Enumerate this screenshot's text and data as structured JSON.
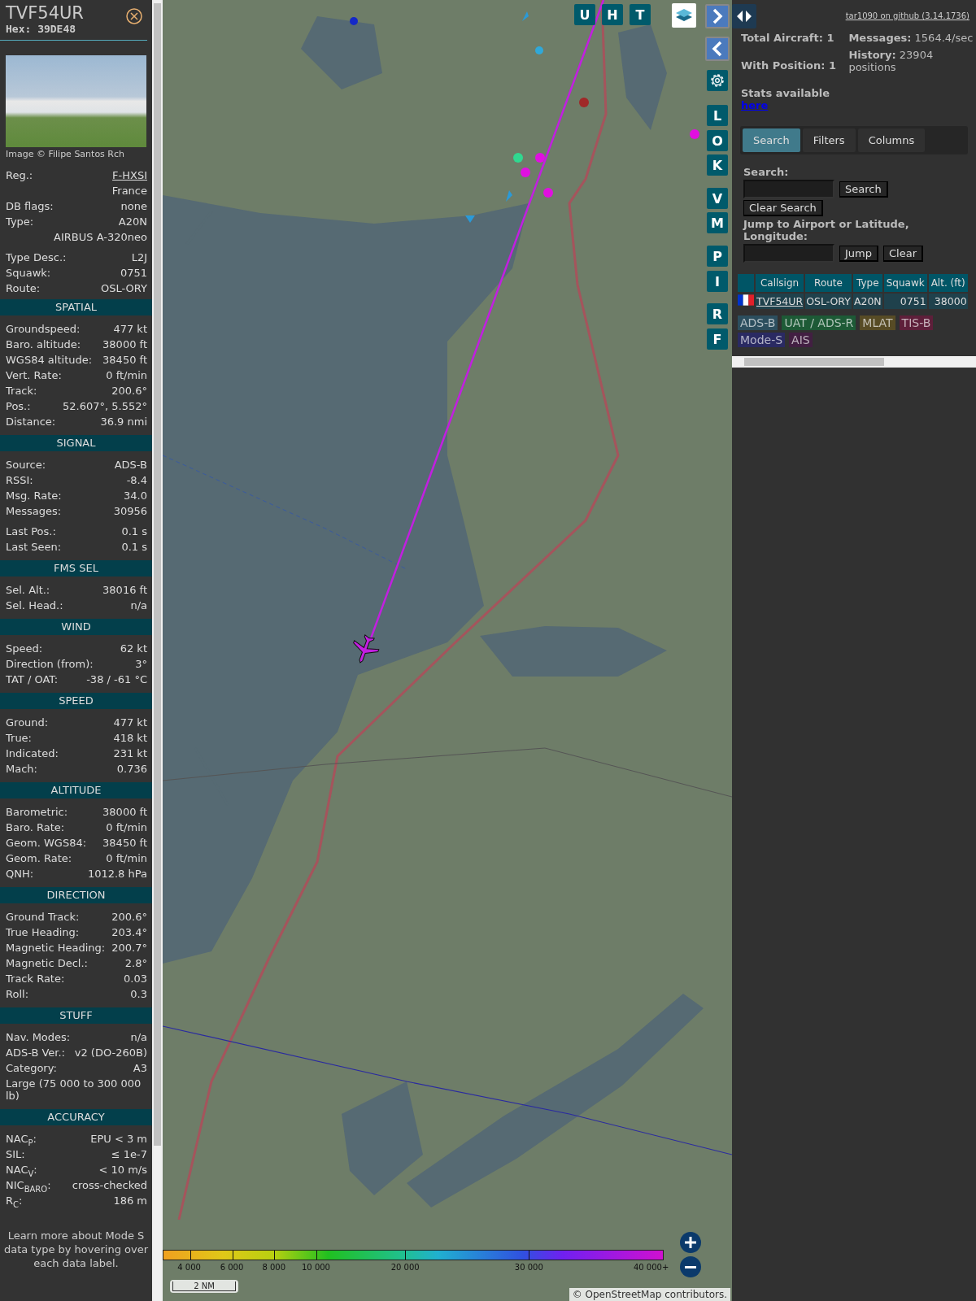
{
  "detail": {
    "callsign": "TVF54UR",
    "hex": "Hex: 39DE48",
    "photo_credit": "Image © Filipe Santos Rch",
    "info_groups": [
      [
        {
          "label": "Reg.:",
          "value": "F-HXSI",
          "kind": "link"
        },
        {
          "value": "France",
          "kind": "text"
        },
        {
          "label": "DB flags:",
          "value": "none",
          "kind": "text"
        },
        {
          "label": "Type:",
          "value": "A20N",
          "kind": "text"
        },
        {
          "value": "AIRBUS A-320neo",
          "kind": "text"
        }
      ],
      [
        {
          "label": "Type Desc.:",
          "value": "L2J",
          "kind": "text"
        },
        {
          "label": "Squawk:",
          "value": "0751",
          "kind": "text"
        },
        {
          "label": "Route:",
          "value": "OSL-ORY",
          "kind": "text"
        }
      ]
    ],
    "sections": [
      {
        "title": "SPATIAL",
        "groups": [
          [
            {
              "label": "Groundspeed:",
              "value": "477 kt",
              "kind": "text"
            },
            {
              "label": "Baro. altitude:",
              "value": "38000 ft",
              "kind": "text"
            },
            {
              "label": "WGS84 altitude:",
              "value": "38450 ft",
              "kind": "text"
            },
            {
              "label": "Vert. Rate:",
              "value": "0 ft/min",
              "kind": "text"
            },
            {
              "label": "Track:",
              "value": "200.6°",
              "kind": "text"
            },
            {
              "label": "Pos.:",
              "value": "52.607°, 5.552°",
              "kind": "text"
            },
            {
              "label": "Distance:",
              "value": "36.9 nmi",
              "kind": "text"
            }
          ]
        ]
      },
      {
        "title": "SIGNAL",
        "groups": [
          [
            {
              "label": "Source:",
              "value": "ADS-B",
              "kind": "text"
            },
            {
              "label": "RSSI:",
              "value": "-8.4",
              "kind": "text"
            },
            {
              "label": "Msg. Rate:",
              "value": "34.0",
              "kind": "text"
            },
            {
              "label": "Messages:",
              "value": "30956",
              "kind": "text"
            }
          ],
          [
            {
              "label": "Last Pos.:",
              "value": "0.1 s",
              "kind": "text"
            },
            {
              "label": "Last Seen:",
              "value": "0.1 s",
              "kind": "text"
            }
          ]
        ]
      },
      {
        "title": "FMS SEL",
        "groups": [
          [
            {
              "label": "Sel. Alt.:",
              "value": "38016 ft",
              "kind": "text"
            },
            {
              "label": "Sel. Head.:",
              "value": "n/a",
              "kind": "text"
            }
          ]
        ]
      },
      {
        "title": "WIND",
        "groups": [
          [
            {
              "label": "Speed:",
              "value": "62 kt",
              "kind": "text"
            },
            {
              "label": "Direction (from):",
              "value": "3°",
              "kind": "text"
            },
            {
              "label": "TAT / OAT:",
              "value": "-38 / -61 °C",
              "kind": "text"
            }
          ]
        ]
      },
      {
        "title": "SPEED",
        "groups": [
          [
            {
              "label": "Ground:",
              "value": "477 kt",
              "kind": "text"
            },
            {
              "label": "True:",
              "value": "418 kt",
              "kind": "text"
            },
            {
              "label": "Indicated:",
              "value": "231 kt",
              "kind": "text"
            },
            {
              "label": "Mach:",
              "value": "0.736",
              "kind": "text"
            }
          ]
        ]
      },
      {
        "title": "ALTITUDE",
        "groups": [
          [
            {
              "label": "Barometric:",
              "value": "38000 ft",
              "kind": "text"
            },
            {
              "label": "Baro. Rate:",
              "value": "0 ft/min",
              "kind": "text"
            },
            {
              "label": "Geom. WGS84:",
              "value": "38450 ft",
              "kind": "text"
            },
            {
              "label": "Geom. Rate:",
              "value": "0 ft/min",
              "kind": "text"
            },
            {
              "label": "QNH:",
              "value": "1012.8 hPa",
              "kind": "text"
            }
          ]
        ]
      },
      {
        "title": "DIRECTION",
        "groups": [
          [
            {
              "label": "Ground Track:",
              "value": "200.6°",
              "kind": "text"
            },
            {
              "label": "True Heading:",
              "value": "203.4°",
              "kind": "text"
            },
            {
              "label": "Magnetic Heading:",
              "value": "200.7°",
              "kind": "text"
            },
            {
              "label": "Magnetic Decl.:",
              "value": "2.8°",
              "kind": "text"
            },
            {
              "label": "Track Rate:",
              "value": "0.03",
              "kind": "text"
            },
            {
              "label": "Roll:",
              "value": "0.3",
              "kind": "text"
            }
          ]
        ]
      },
      {
        "title": "STUFF",
        "groups": [
          [
            {
              "label": "Nav. Modes:",
              "value": "n/a",
              "kind": "text"
            },
            {
              "label": "ADS-B Ver.:",
              "value": "v2 (DO-260B)",
              "kind": "text"
            },
            {
              "label": "Category:",
              "value": "A3",
              "kind": "text"
            },
            {
              "value": "Large (75 000 to 300 000 lb)",
              "kind": "note"
            }
          ]
        ]
      },
      {
        "title": "ACCURACY",
        "groups": [
          [
            {
              "label": "NAC$_{P}$:",
              "value": "EPU < 3 m",
              "kind": "text"
            },
            {
              "label": "SIL:",
              "value": "≤ 1e-7",
              "kind": "text"
            },
            {
              "label": "NAC$_{V}$:",
              "value": "< 10 m/s",
              "kind": "text"
            },
            {
              "label": "NIC$_{BARO}$:",
              "value": "cross-checked",
              "kind": "text"
            },
            {
              "label": "R$_{C}$:",
              "value": "186 m",
              "kind": "text"
            }
          ]
        ]
      }
    ],
    "footer_note": "Learn more about Mode S data type by hovering over each data label."
  },
  "map": {
    "top_buttons": [
      "U",
      "H",
      "T"
    ],
    "side_buttons": [
      "L",
      "O",
      "K",
      "V",
      "M",
      "P",
      "I",
      "R",
      "F"
    ],
    "altitude_scale": [
      "4 000",
      "6 000",
      "8 000",
      "10 000",
      "20 000",
      "30 000",
      "40 000+"
    ],
    "distance_scale": "2 NM",
    "attribution": "© OpenStreetMap contributors."
  },
  "right_panel": {
    "github_link": "tar1090 on github (3.14.1736)",
    "stats_left": [
      {
        "label": "Total Aircraft:",
        "value": "1"
      },
      {
        "label": "With Position:",
        "value": "1"
      }
    ],
    "stats_right": [
      {
        "label": "Messages:",
        "value": "1564.4/sec"
      },
      {
        "label": "History:",
        "value": "23904 positions"
      }
    ],
    "stats_link_text": "Stats available",
    "stats_link": "here",
    "tabs": [
      {
        "label": "Search",
        "selected": true
      },
      {
        "label": "Filters",
        "selected": false
      },
      {
        "label": "Columns",
        "selected": false
      }
    ],
    "search_label": "Search:",
    "search_button": "Search",
    "clear_search_button": "Clear Search",
    "jump_label": "Jump to Airport or Latitude, Longitude:",
    "jump_button": "Jump",
    "clear_button": "Clear",
    "table": {
      "columns": [
        "Callsign",
        "Route",
        "Type",
        "Squawk",
        "Alt. (ft)"
      ],
      "rows": [
        {
          "cells": [
            "TVF54UR",
            "OSL-ORY",
            "A20N",
            "0751",
            "38000"
          ]
        }
      ]
    },
    "sources": [
      {
        "label": "ADS-B",
        "color": "#2c4e5e"
      },
      {
        "label": "UAT / ADS-R",
        "color": "#1d5a36"
      },
      {
        "label": "MLAT",
        "color": "#574b25"
      },
      {
        "label": "TIS-B",
        "color": "#5e1f3a"
      },
      {
        "label": "Mode-S",
        "color": "#2a2a62"
      },
      {
        "label": "AIS",
        "color": "#421f42"
      }
    ]
  }
}
